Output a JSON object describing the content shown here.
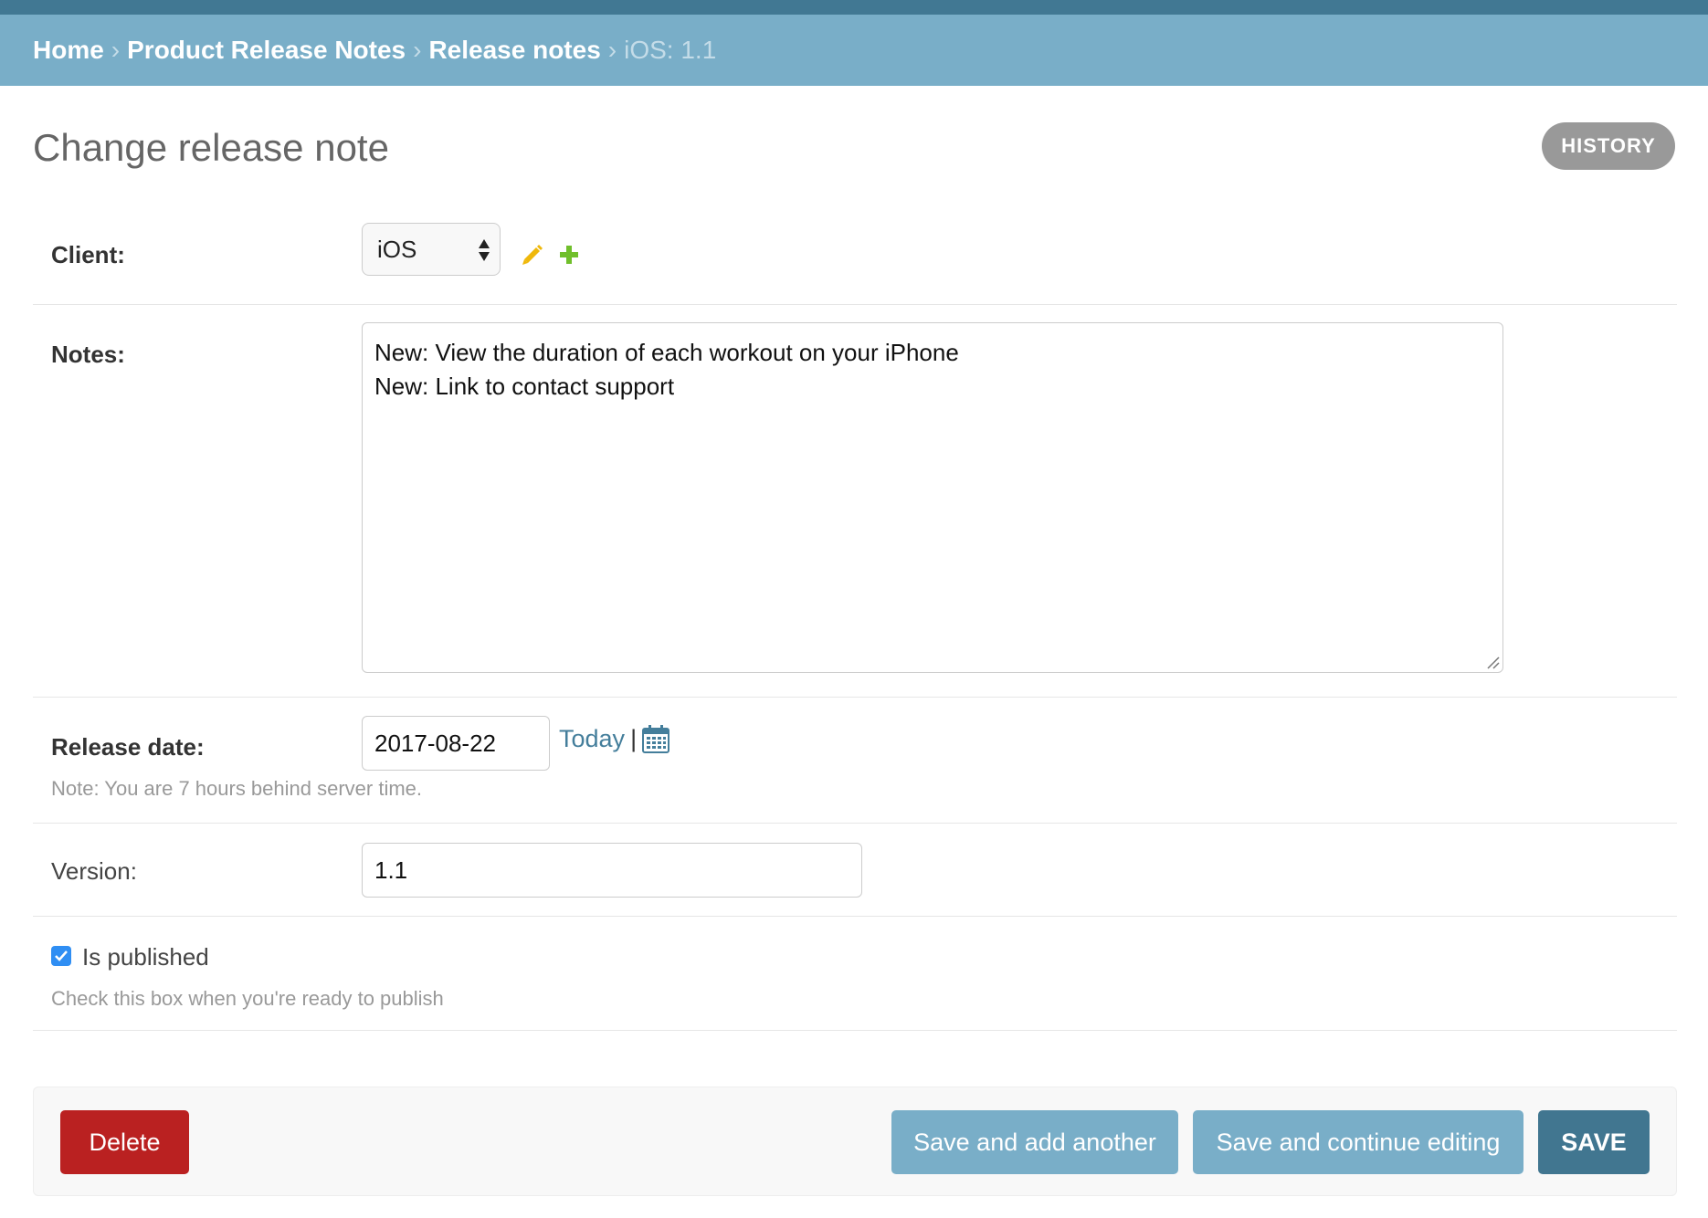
{
  "breadcrumbs": {
    "home": "Home",
    "app": "Product Release Notes",
    "model": "Release notes",
    "current": "iOS: 1.1",
    "separator": "›"
  },
  "page": {
    "title": "Change release note",
    "history_label": "HISTORY"
  },
  "form": {
    "client": {
      "label": "Client:",
      "selected": "iOS",
      "edit_icon": "pencil-icon",
      "add_icon": "plus-icon"
    },
    "notes": {
      "label": "Notes:",
      "line1": "New: View the duration of each workout on your iPhone",
      "line2": "New: Link to contact support"
    },
    "release_date": {
      "label": "Release date:",
      "value": "2017-08-22",
      "today_label": "Today",
      "pipe": "|",
      "calendar_icon": "calendar-icon",
      "help": "Note: You are 7 hours behind server time."
    },
    "version": {
      "label": "Version:",
      "value": "1.1"
    },
    "is_published": {
      "label": "Is published",
      "checked": true,
      "help": "Check this box when you're ready to publish"
    }
  },
  "actions": {
    "delete": "Delete",
    "save_add_another": "Save and add another",
    "save_continue": "Save and continue editing",
    "save": "SAVE"
  },
  "colors": {
    "header_dark": "#417893",
    "breadcrumb_bg": "#79aec8",
    "delete": "#ba2121",
    "save": "#417690",
    "link": "#447e9b",
    "checkbox": "#2f8ef3"
  }
}
